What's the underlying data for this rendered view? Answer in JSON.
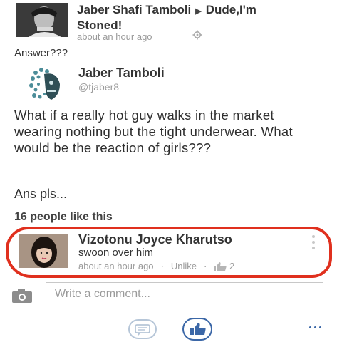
{
  "post": {
    "author": "Jaber Shafi Tamboli",
    "target_line1": "Dude,I'm",
    "target_line2": "Stoned!",
    "time": "about an hour ago",
    "message": "Answer???",
    "icons": {
      "author_avatar": "profile-photo",
      "settings": "gear-icon",
      "arrow": "right-triangle-icon"
    }
  },
  "shared": {
    "name": "Jaber Tamboli",
    "handle": "@tjaber8",
    "body": "What if a really hot guy walks in the market wearing nothing but the tight underwear. What would be the reaction of girls???",
    "ans": "Ans pls..."
  },
  "likes": {
    "text": "16 people like this"
  },
  "comment": {
    "name": "Vizotonu Joyce Kharutso",
    "text": "swoon over him",
    "time": "about an hour ago",
    "unlike_label": "Unlike",
    "like_count": "2"
  },
  "composer": {
    "placeholder": "Write a comment..."
  },
  "colors": {
    "accent": "#3b67a7",
    "highlight": "#e0301e",
    "muted": "#9a9a9a"
  }
}
